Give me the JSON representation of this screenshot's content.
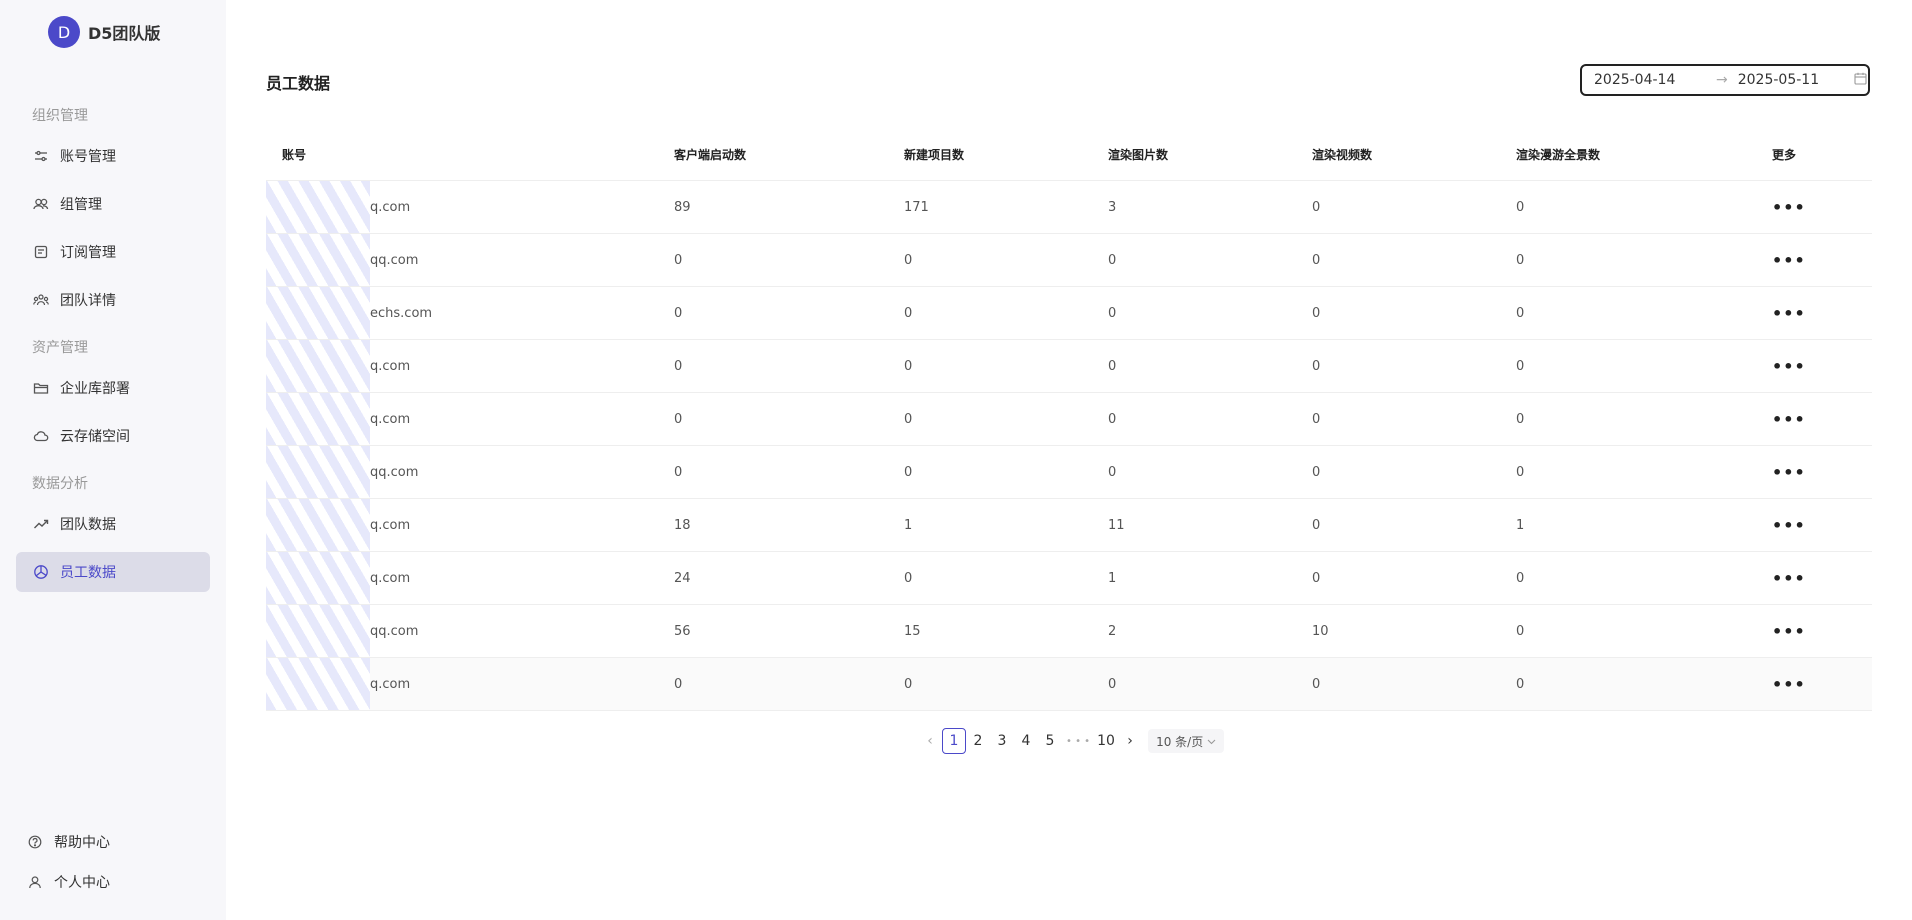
{
  "brand": {
    "avatar_letter": "D",
    "name": "D5团队版",
    "accent": "#4b49c9"
  },
  "sidebar": {
    "sections": [
      {
        "title": "组织管理",
        "items": [
          {
            "label": "账号管理",
            "icon": "sliders-icon"
          },
          {
            "label": "组管理",
            "icon": "users-icon"
          },
          {
            "label": "订阅管理",
            "icon": "document-icon"
          },
          {
            "label": "团队详情",
            "icon": "team-icon"
          }
        ]
      },
      {
        "title": "资产管理",
        "items": [
          {
            "label": "企业库部署",
            "icon": "folder-icon"
          },
          {
            "label": "云存储空间",
            "icon": "cloud-icon"
          }
        ]
      },
      {
        "title": "数据分析",
        "items": [
          {
            "label": "团队数据",
            "icon": "trend-icon"
          },
          {
            "label": "员工数据",
            "icon": "pie-icon",
            "active": true
          }
        ]
      }
    ],
    "bottom": [
      {
        "label": "帮助中心",
        "icon": "help-icon"
      },
      {
        "label": "个人中心",
        "icon": "user-icon"
      }
    ]
  },
  "page": {
    "title": "员工数据"
  },
  "date_range": {
    "start": "2025-04-14",
    "end": "2025-05-11"
  },
  "table": {
    "columns": [
      "账号",
      "客户端启动数",
      "新建项目数",
      "渲染图片数",
      "渲染视频数",
      "渲染漫游全景数",
      "更多"
    ],
    "rows": [
      {
        "account": "q.com",
        "client": "89",
        "projects": "171",
        "images": "3",
        "videos": "0",
        "panos": "0"
      },
      {
        "account": "qq.com",
        "client": "0",
        "projects": "0",
        "images": "0",
        "videos": "0",
        "panos": "0"
      },
      {
        "account": "echs.com",
        "client": "0",
        "projects": "0",
        "images": "0",
        "videos": "0",
        "panos": "0"
      },
      {
        "account": "q.com",
        "client": "0",
        "projects": "0",
        "images": "0",
        "videos": "0",
        "panos": "0"
      },
      {
        "account": "q.com",
        "client": "0",
        "projects": "0",
        "images": "0",
        "videos": "0",
        "panos": "0"
      },
      {
        "account": "qq.com",
        "client": "0",
        "projects": "0",
        "images": "0",
        "videos": "0",
        "panos": "0"
      },
      {
        "account": "q.com",
        "client": "18",
        "projects": "1",
        "images": "11",
        "videos": "0",
        "panos": "1"
      },
      {
        "account": "q.com",
        "client": "24",
        "projects": "0",
        "images": "1",
        "videos": "0",
        "panos": "0"
      },
      {
        "account": "qq.com",
        "client": "56",
        "projects": "15",
        "images": "2",
        "videos": "10",
        "panos": "0"
      },
      {
        "account": "q.com",
        "client": "0",
        "projects": "0",
        "images": "0",
        "videos": "0",
        "panos": "0"
      }
    ]
  },
  "pagination": {
    "pages": [
      "1",
      "2",
      "3",
      "4",
      "5"
    ],
    "ellipsis": "• • •",
    "last": "10",
    "current": "1",
    "page_size": "10 条/页"
  }
}
